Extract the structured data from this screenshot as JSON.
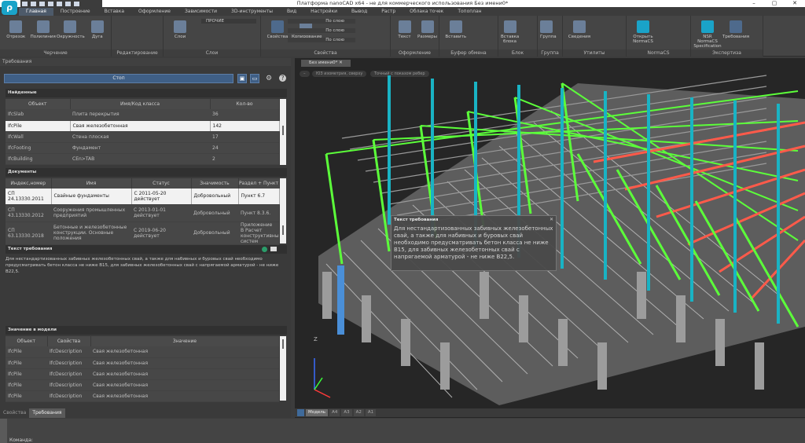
{
  "window": {
    "title": "Платформа nanoCAD x64 - не для коммерческого использования Без имени0*",
    "controls": [
      "–",
      "▢",
      "✕"
    ]
  },
  "ribbon_tabs": [
    "Главная",
    "Построение",
    "Вставка",
    "Оформление",
    "Зависимости",
    "3D-инструменты",
    "Вид",
    "Настройки",
    "Вывод",
    "Растр",
    "Облака точек",
    "Топоплан"
  ],
  "ribbon_groups": [
    {
      "label": "Черчение",
      "buttons": [
        "Отрезок",
        "Полилиния",
        "Окружность",
        "Дуга"
      ]
    },
    {
      "label": "Редактирование",
      "buttons": []
    },
    {
      "label": "Слои",
      "buttons": [
        "Слои"
      ],
      "layer": "ПРОЧИЕ"
    },
    {
      "label": "Свойства",
      "buttons": [
        "Свойства",
        "Копирование свойств"
      ],
      "props": [
        "По слою",
        "По слою",
        "По слою"
      ]
    },
    {
      "label": "Оформление",
      "buttons": [
        "Текст",
        "Размеры"
      ]
    },
    {
      "label": "Буфер обмена",
      "buttons": [
        "Вставить"
      ]
    },
    {
      "label": "Блок",
      "buttons": [
        "Вставка блока"
      ]
    },
    {
      "label": "Группа",
      "buttons": [
        "Группа"
      ]
    },
    {
      "label": "Утилиты",
      "buttons": [
        "Сведения"
      ]
    },
    {
      "label": "NormaCS",
      "buttons": [
        "Открыть NormaCS"
      ]
    },
    {
      "label": "Экспертиза",
      "buttons": [
        "NSR NormaCS Specification",
        "Требования"
      ]
    }
  ],
  "panel": {
    "title": "Требования",
    "stop_label": "Стоп",
    "found": {
      "title": "Найденные",
      "columns": [
        "Объект",
        "Имя/Код класса",
        "Кол-во"
      ],
      "rows": [
        [
          "IfcSlab",
          "Плита перекрытия",
          "36"
        ],
        [
          "IfcPile",
          "Свая железобетонная",
          "142"
        ],
        [
          "IfcWall",
          "Стена плоская",
          "17"
        ],
        [
          "IfcFooting",
          "Фундамент",
          "24"
        ],
        [
          "IfcBuilding",
          "CEn>TAB",
          "2"
        ]
      ]
    },
    "docs": {
      "title": "Документы",
      "columns": [
        "Индекс,номер",
        "Имя",
        "Статус",
        "Значимость",
        "Раздел + Пункт"
      ],
      "rows": [
        [
          "СП 24.13330.2011",
          "Свайные фундаменты",
          "С 2011-05-20 действует",
          "Добровольный",
          "Пункт 6.7"
        ],
        [
          "СП 43.13330.2012",
          "Сооружения промышленных предприятий",
          "С 2013-01-01 действует",
          "Добровольный",
          "Пункт 8.3.6."
        ],
        [
          "СП 63.13330.2018",
          "Бетонные и железобетонные конструкции. Основные положения",
          "С 2019-06-20 действует",
          "Добровольный",
          "Приложение В Расчет конструктивных систем"
        ]
      ]
    },
    "req_title": "Текст требования",
    "req_text": "Для нестандартизованных забивных железобетонных свай, а также для набивных и буровых свай необходимо предусматривать бетон класса не ниже B15, для забивных железобетонных свай с напрягаемой арматурой - не ниже B22,5.",
    "model": {
      "title": "Значение в модели",
      "columns": [
        "Объект",
        "Свойства",
        "Значение"
      ],
      "rows": [
        [
          "IfcPile",
          "IfcDescription",
          "Свая железобетонная"
        ],
        [
          "IfcPile",
          "IfcDescription",
          "Свая железобетонная"
        ],
        [
          "IfcPile",
          "IfcDescription",
          "Свая железобетонная"
        ],
        [
          "IfcPile",
          "IfcDescription",
          "Свая железобетонная"
        ],
        [
          "IfcPile",
          "IfcDescription",
          "Свая железобетонная"
        ]
      ]
    },
    "bottom_tabs": [
      "Свойства",
      "Требования"
    ]
  },
  "viewport": {
    "tab": "Без имени0*",
    "view_pills": [
      "–",
      "ЮЗ изометрия, сверху",
      "Точный с показом ребер"
    ],
    "tooltip": {
      "title": "Текст требования",
      "text": "Для нестандартизованных забивных железобетонных свай, а также для набивных и буровых свай необходимо предусматривать бетон класса не ниже B15, для забивных железобетонных свай с напрягаемой арматурой - не ниже B22,5."
    },
    "layouts": [
      "Модель",
      "A4",
      "A3",
      "A2",
      "A1"
    ],
    "axis_z": "Z"
  },
  "command": {
    "label": "Команда:"
  },
  "colors": {
    "accent": "#3f5f86",
    "green": "#5cff3a",
    "red": "#ff5a4a",
    "cyan": "#19b3c4"
  }
}
